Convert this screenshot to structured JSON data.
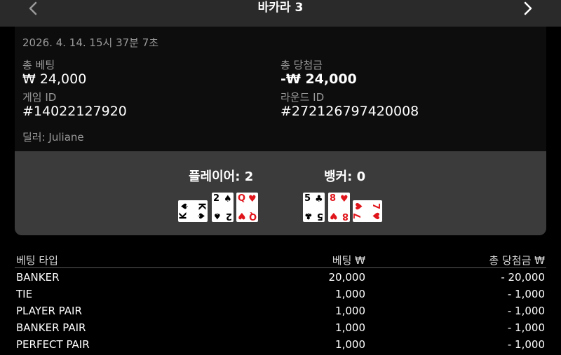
{
  "header": {
    "title": "바카라 3",
    "prev_icon": "chevron-left-icon",
    "next_icon": "chevron-right-icon"
  },
  "details": {
    "datetime": "2026. 4. 14. 15시 37분 7초",
    "total_bet_label": "총 베팅",
    "total_bet_value": "₩ 24,000",
    "total_win_label": "총 당첨금",
    "total_win_value": "-₩ 24,000",
    "game_id_label": "게임 ID",
    "game_id_value": "#14022127920",
    "round_id_label": "라운드 ID",
    "round_id_value": "#272126797420008",
    "dealer": "딜러: Juliane"
  },
  "result": {
    "player_label": "플레이어: 2",
    "banker_label": "뱅커: 0",
    "player_cards": [
      {
        "rank": "K",
        "suit": "♠",
        "color": "black"
      },
      {
        "rank": "2",
        "suit": "♠",
        "color": "black"
      },
      {
        "rank": "Q",
        "suit": "♥",
        "color": "red"
      }
    ],
    "banker_cards": [
      {
        "rank": "5",
        "suit": "♣",
        "color": "black"
      },
      {
        "rank": "8",
        "suit": "♥",
        "color": "red"
      },
      {
        "rank": "7",
        "suit": "♥",
        "color": "red"
      }
    ]
  },
  "bets": {
    "headers": [
      "베팅 타입",
      "베팅 ₩",
      "총 당첨금 ₩"
    ],
    "rows": [
      {
        "type": "BANKER",
        "bet": "20,000",
        "win": "- 20,000"
      },
      {
        "type": "TIE",
        "bet": "1,000",
        "win": "- 1,000"
      },
      {
        "type": "PLAYER PAIR",
        "bet": "1,000",
        "win": "- 1,000"
      },
      {
        "type": "BANKER PAIR",
        "bet": "1,000",
        "win": "- 1,000"
      },
      {
        "type": "PERFECT PAIR",
        "bet": "1,000",
        "win": "- 1,000"
      }
    ]
  }
}
